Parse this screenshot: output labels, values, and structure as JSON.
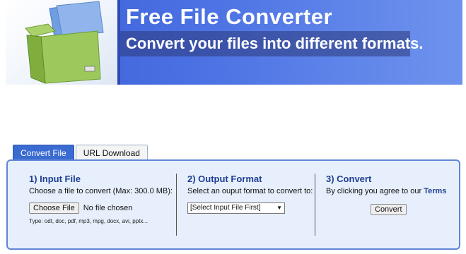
{
  "banner": {
    "title": "Free File Converter",
    "subtitle": "Convert your files into different formats."
  },
  "tabs": [
    {
      "label": "Convert File",
      "active": true
    },
    {
      "label": "URL Download",
      "active": false
    }
  ],
  "step1": {
    "heading": "1) Input File",
    "description": "Choose a file to convert (Max: 300.0 MB):",
    "choose_button": "Choose File",
    "file_status": "No file chosen",
    "types_hint": "Type: odt, doc, pdf, mp3, mpg, docx, avi, pptx..."
  },
  "step2": {
    "heading": "2) Output Format",
    "description": "Select an ouput format to convert to:",
    "select_value": "[Select Input File First]"
  },
  "step3": {
    "heading": "3) Convert",
    "description_prefix": "By clicking you agree to our",
    "terms_link": "Terms",
    "convert_button": "Convert"
  },
  "colors": {
    "banner_blue": "#4a70e3",
    "active_tab": "#3a6bd0",
    "panel_bg": "#e6effb",
    "panel_border": "#5f86d8",
    "heading_text": "#1f3f93"
  },
  "icons": {
    "banner_image": "green-box-with-files",
    "select_arrow": "triangle-down"
  }
}
